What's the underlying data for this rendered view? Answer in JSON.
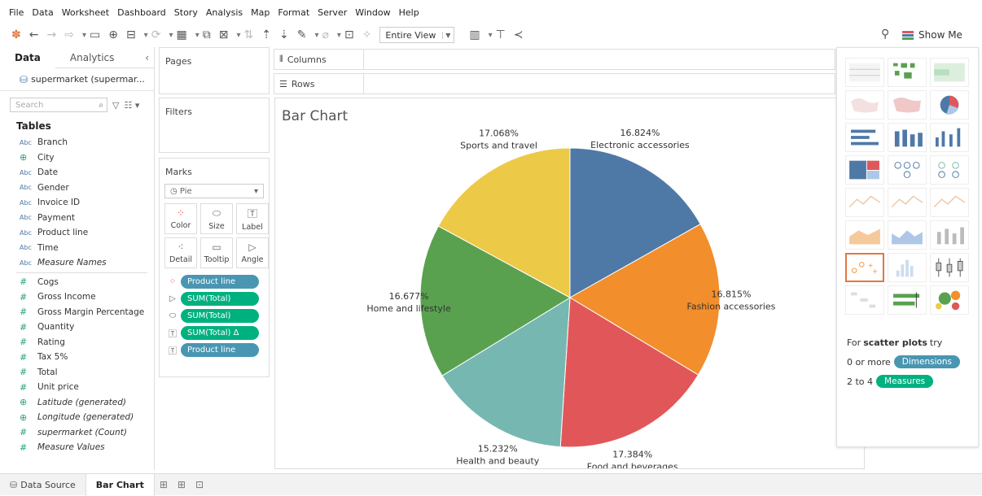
{
  "menu": [
    "File",
    "Data",
    "Worksheet",
    "Dashboard",
    "Story",
    "Analysis",
    "Map",
    "Format",
    "Server",
    "Window",
    "Help"
  ],
  "toolbar": {
    "view_select": "Entire View",
    "show_me_label": "Show Me"
  },
  "left_pane": {
    "tabs": [
      "Data",
      "Analytics"
    ],
    "datasource": "supermarket (supermar...",
    "search_placeholder": "Search",
    "tables_header": "Tables",
    "dimensions": [
      {
        "type": "Abc",
        "name": "Branch"
      },
      {
        "type": "geo",
        "name": "City"
      },
      {
        "type": "Abc",
        "name": "Date"
      },
      {
        "type": "Abc",
        "name": "Gender"
      },
      {
        "type": "Abc",
        "name": "Invoice ID"
      },
      {
        "type": "Abc",
        "name": "Payment"
      },
      {
        "type": "Abc",
        "name": "Product line"
      },
      {
        "type": "Abc",
        "name": "Time"
      },
      {
        "type": "Abc",
        "name": "Measure Names",
        "italic": true
      }
    ],
    "measures": [
      {
        "type": "#",
        "name": "Cogs"
      },
      {
        "type": "#",
        "name": "Gross Income"
      },
      {
        "type": "#",
        "name": "Gross Margin Percentage"
      },
      {
        "type": "#",
        "name": "Quantity"
      },
      {
        "type": "#",
        "name": "Rating"
      },
      {
        "type": "#",
        "name": "Tax 5%"
      },
      {
        "type": "#",
        "name": "Total"
      },
      {
        "type": "#",
        "name": "Unit price"
      },
      {
        "type": "geo",
        "name": "Latitude (generated)",
        "italic": true
      },
      {
        "type": "geo",
        "name": "Longitude (generated)",
        "italic": true
      },
      {
        "type": "#",
        "name": "supermarket (Count)",
        "italic": true
      },
      {
        "type": "#",
        "name": "Measure Values",
        "italic": true
      }
    ]
  },
  "cards": {
    "pages": "Pages",
    "filters": "Filters",
    "marks": "Marks",
    "mark_type": "Pie",
    "mark_buttons": [
      "Color",
      "Size",
      "Label",
      "Detail",
      "Tooltip",
      "Angle"
    ],
    "pills": [
      {
        "icon": "color",
        "label": "Product line",
        "kind": "dim"
      },
      {
        "icon": "angle",
        "label": "SUM(Total)",
        "kind": "meas"
      },
      {
        "icon": "size",
        "label": "SUM(Total)",
        "kind": "meas"
      },
      {
        "icon": "label",
        "label": "SUM(Total)  Δ",
        "kind": "meas"
      },
      {
        "icon": "label",
        "label": "Product line",
        "kind": "dim"
      }
    ]
  },
  "shelves": {
    "columns": "Columns",
    "rows": "Rows"
  },
  "chart_data": {
    "type": "pie",
    "title": "Bar Chart",
    "slices": [
      {
        "label": "Electronic accessories",
        "pct_label": "16.824%",
        "value": 16.824,
        "color": "#4e79a7"
      },
      {
        "label": "Fashion accessories",
        "pct_label": "16.815%",
        "value": 16.815,
        "color": "#f28e2b"
      },
      {
        "label": "Food and beverages",
        "pct_label": "17.384%",
        "value": 17.384,
        "color": "#e15759"
      },
      {
        "label": "Health and beauty",
        "pct_label": "15.232%",
        "value": 15.232,
        "color": "#76b7b2"
      },
      {
        "label": "Home and lifestyle",
        "pct_label": "16.677%",
        "value": 16.677,
        "color": "#59a14f"
      },
      {
        "label": "Sports and travel",
        "pct_label": "17.068%",
        "value": 17.068,
        "color": "#edc948"
      }
    ]
  },
  "show_me": {
    "hint_prefix": "For",
    "hint_bold": "scatter plots",
    "hint_suffix": "try",
    "dim_req": "0 or more",
    "dim_pill": "Dimensions",
    "meas_req": "2 to 4",
    "meas_pill": "Measures"
  },
  "bottom": {
    "data_source": "Data Source",
    "active_sheet": "Bar Chart"
  }
}
